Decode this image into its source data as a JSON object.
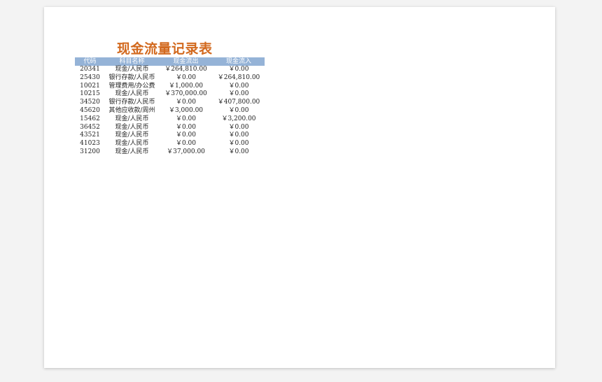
{
  "sheet": {
    "title": "现金流量记录表",
    "headers": {
      "code": "代码",
      "account": "科目名称",
      "outflow": "现金流出",
      "inflow": "现金流入"
    },
    "rows": [
      {
        "code": "20341",
        "account": "现金/人民币",
        "outflow": "￥264,810.00",
        "inflow": "￥0.00"
      },
      {
        "code": "25430",
        "account": "银行存款/人民币",
        "outflow": "￥0.00",
        "inflow": "￥264,810.00"
      },
      {
        "code": "10021",
        "account": "管理费用/办公费",
        "outflow": "￥1,000.00",
        "inflow": "￥0.00"
      },
      {
        "code": "10215",
        "account": "现金/人民币",
        "outflow": "￥370,000.00",
        "inflow": "￥0.00"
      },
      {
        "code": "34520",
        "account": "银行存款/人民币",
        "outflow": "￥0.00",
        "inflow": "￥407,800.00"
      },
      {
        "code": "45620",
        "account": "其他应收款/周州",
        "outflow": "￥3,000.00",
        "inflow": "￥0.00"
      },
      {
        "code": "15462",
        "account": "现金/人民币",
        "outflow": "￥0.00",
        "inflow": "￥3,200.00"
      },
      {
        "code": "36452",
        "account": "现金/人民币",
        "outflow": "￥0.00",
        "inflow": "￥0.00"
      },
      {
        "code": "43521",
        "account": "现金/人民币",
        "outflow": "￥0.00",
        "inflow": "￥0.00"
      },
      {
        "code": "41023",
        "account": "现金/人民币",
        "outflow": "￥0.00",
        "inflow": "￥0.00"
      },
      {
        "code": "31200",
        "account": "现金/人民币",
        "outflow": "￥37,000.00",
        "inflow": "￥0.00"
      }
    ]
  },
  "colors": {
    "title": "#d2691e",
    "header_bg": "#95b3d7",
    "header_text": "#ffffff"
  }
}
